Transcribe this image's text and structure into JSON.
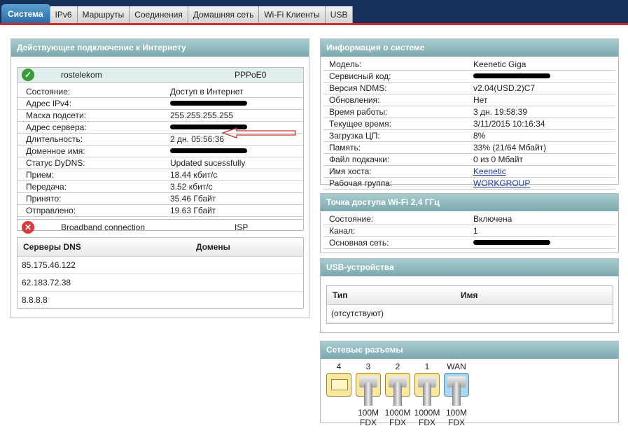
{
  "tabs": [
    "Система",
    "IPv6",
    "Маршруты",
    "Соединения",
    "Домашняя сеть",
    "Wi-Fi Клиенты",
    "USB"
  ],
  "internet": {
    "title": "Действующее подключение к Интернету",
    "conn": {
      "name": "rostelekom",
      "iface": "PPPoE0",
      "status_icon": "check-icon"
    },
    "rows": [
      [
        "Состояние:",
        "Доступ в Интернет"
      ],
      [
        "Адрес IPv4:",
        ""
      ],
      [
        "Маска подсети:",
        "255.255.255.255"
      ],
      [
        "Адрес сервера:",
        ""
      ],
      [
        "Длительность:",
        "2 дн. 05:56:36"
      ],
      [
        "Доменное имя:",
        ""
      ],
      [
        "Статус DyDNS:",
        "Updated sucessfully"
      ],
      [
        "Прием:",
        "18.44 кбит/с"
      ],
      [
        "Передача:",
        "3.52 кбит/с"
      ],
      [
        "Принято:",
        "35.46 Гбайт"
      ],
      [
        "Отправлено:",
        "19.63 Гбайт"
      ]
    ],
    "conn2": {
      "name": "Broadband connection",
      "iface": "ISP",
      "status_icon": "error-icon"
    }
  },
  "dns": {
    "col1": "Серверы DNS",
    "col2": "Домены",
    "servers": [
      "85.175.46.122",
      "62.183.72.38",
      "8.8.8.8"
    ]
  },
  "sysinfo": {
    "title": "Информация о системе",
    "rows": [
      [
        "Модель:",
        "Keenetic Giga"
      ],
      [
        "Сервисный код:",
        ""
      ],
      [
        "Версия NDMS:",
        "v2.04(USD.2)C7"
      ],
      [
        "Обновления:",
        "Нет"
      ],
      [
        "Время работы:",
        "3 дн. 19:58:39"
      ],
      [
        "Текущее время:",
        "3/11/2015 10:16:34"
      ],
      [
        "Загрузка ЦП:",
        "8%"
      ],
      [
        "Память:",
        "33% (21/64 Мбайт)"
      ],
      [
        "Файл подкачки:",
        "0 из 0 Мбайт"
      ],
      [
        "Имя хоста:",
        "Keenetic"
      ],
      [
        "Рабочая группа:",
        "WORKGROUP"
      ]
    ]
  },
  "wifi": {
    "title": "Точка доступа Wi-Fi 2,4 ГГц",
    "rows": [
      [
        "Состояние:",
        "Включена"
      ],
      [
        "Канал:",
        "1"
      ],
      [
        "Основная сеть:",
        ""
      ]
    ]
  },
  "usb": {
    "title": "USB-устройства",
    "col1": "Тип",
    "col2": "Имя",
    "empty": "(отсутствуют)"
  },
  "ports": {
    "title": "Сетевые разъемы",
    "items": [
      {
        "label": "4",
        "speed": "",
        "duplex": ""
      },
      {
        "label": "3",
        "speed": "100M",
        "duplex": "FDX"
      },
      {
        "label": "2",
        "speed": "1000M",
        "duplex": "FDX"
      },
      {
        "label": "1",
        "speed": "1000M",
        "duplex": "FDX"
      },
      {
        "label": "WAN",
        "speed": "100M",
        "duplex": "FDX"
      }
    ]
  },
  "colors": {
    "accent": "#2a6aa8",
    "topbar": "#17325a",
    "panel_header": "#7aa8ad",
    "arrow": "#d02a2a"
  }
}
